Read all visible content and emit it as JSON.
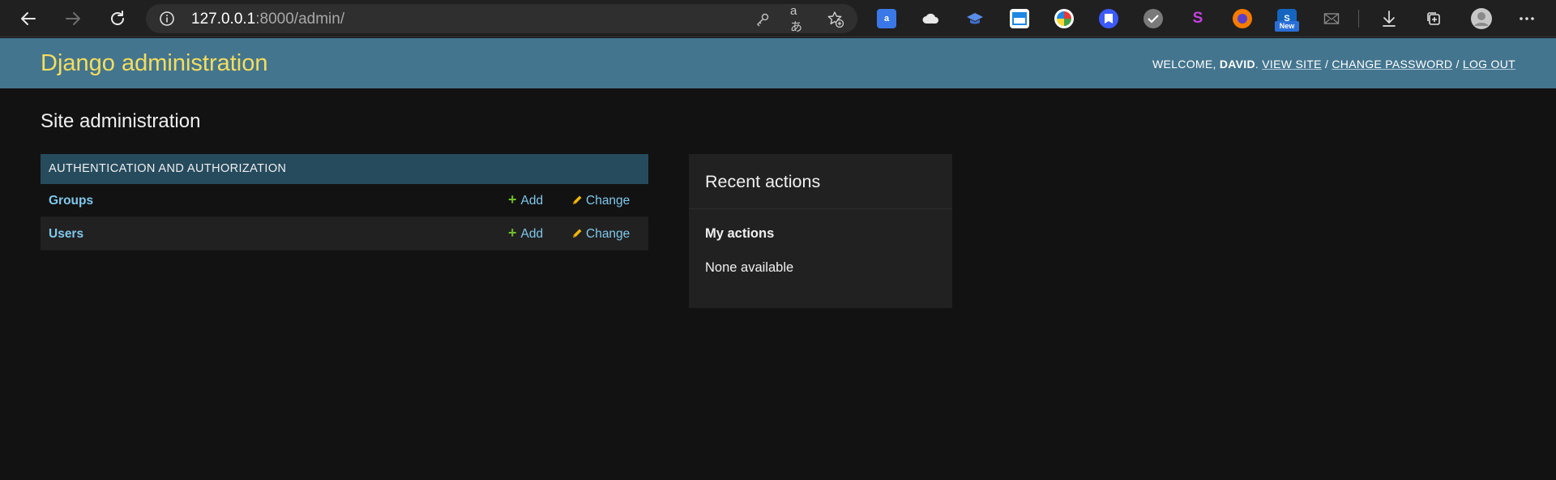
{
  "browser": {
    "url_host": "127.0.0.1",
    "url_path": ":8000/admin/",
    "ext_new_badge": "New"
  },
  "header": {
    "brand": "Django administration",
    "welcome_prefix": "WELCOME, ",
    "username": "DAVID",
    "welcome_suffix": ". ",
    "view_site": "VIEW SITE",
    "sep1": " / ",
    "change_password": "CHANGE PASSWORD",
    "sep2": " / ",
    "log_out": "LOG OUT",
    "brand_color": "#f5dd5d",
    "bar_color": "#44758e"
  },
  "main": {
    "title": "Site administration",
    "app_module": {
      "caption": "AUTHENTICATION AND AUTHORIZATION",
      "models": [
        {
          "name": "Groups",
          "add": "Add",
          "change": "Change"
        },
        {
          "name": "Users",
          "add": "Add",
          "change": "Change"
        }
      ]
    }
  },
  "recent_actions": {
    "title": "Recent actions",
    "subtitle": "My actions",
    "empty": "None available"
  },
  "icons": [
    "back-arrow-icon",
    "forward-arrow-icon",
    "reload-icon",
    "info-icon",
    "key-icon",
    "read-aloud-icon",
    "favorite-add-icon",
    "downloads-icon",
    "collections-icon",
    "profile-icon",
    "more-icon"
  ]
}
